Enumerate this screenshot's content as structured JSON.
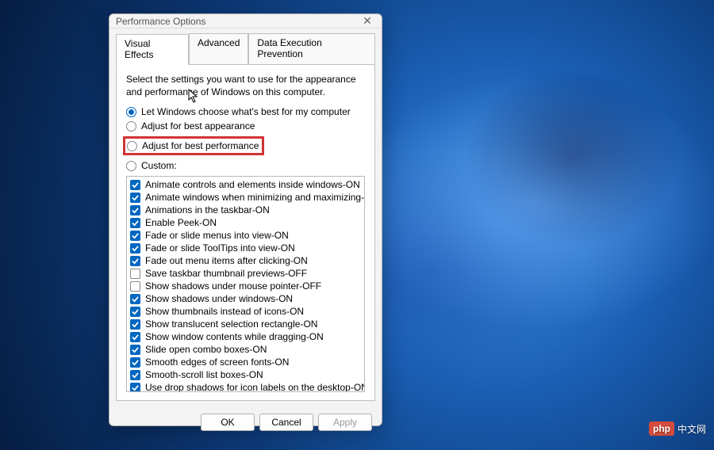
{
  "dialog": {
    "title": "Performance Options",
    "tabs": [
      {
        "label": "Visual Effects",
        "active": true
      },
      {
        "label": "Advanced",
        "active": false
      },
      {
        "label": "Data Execution Prevention",
        "active": false
      }
    ],
    "description": "Select the settings you want to use for the appearance and performance of Windows on this computer.",
    "radios": [
      {
        "label": "Let Windows choose what's best for my computer",
        "selected": true,
        "highlight": false
      },
      {
        "label": "Adjust for best appearance",
        "selected": false,
        "highlight": false
      },
      {
        "label": "Adjust for best performance",
        "selected": false,
        "highlight": true
      },
      {
        "label": "Custom:",
        "selected": false,
        "highlight": false
      }
    ],
    "checks": [
      {
        "label": "Animate controls and elements inside windows-ON",
        "checked": true
      },
      {
        "label": "Animate windows when minimizing and maximizing-ON",
        "checked": true
      },
      {
        "label": "Animations in the taskbar-ON",
        "checked": true
      },
      {
        "label": "Enable Peek-ON",
        "checked": true
      },
      {
        "label": "Fade or slide menus into view-ON",
        "checked": true
      },
      {
        "label": "Fade or slide ToolTips into view-ON",
        "checked": true
      },
      {
        "label": "Fade out menu items after clicking-ON",
        "checked": true
      },
      {
        "label": "Save taskbar thumbnail previews-OFF",
        "checked": false
      },
      {
        "label": "Show shadows under mouse pointer-OFF",
        "checked": false
      },
      {
        "label": "Show shadows under windows-ON",
        "checked": true
      },
      {
        "label": "Show thumbnails instead of icons-ON",
        "checked": true
      },
      {
        "label": "Show translucent selection rectangle-ON",
        "checked": true
      },
      {
        "label": "Show window contents while dragging-ON",
        "checked": true
      },
      {
        "label": "Slide open combo boxes-ON",
        "checked": true
      },
      {
        "label": "Smooth edges of screen fonts-ON",
        "checked": true
      },
      {
        "label": "Smooth-scroll list boxes-ON",
        "checked": true
      },
      {
        "label": "Use drop shadows for icon labels on the desktop-ON",
        "checked": true
      }
    ],
    "buttons": {
      "ok": "OK",
      "cancel": "Cancel",
      "apply": "Apply"
    }
  },
  "watermark": {
    "logo": "php",
    "text": "中文网"
  }
}
